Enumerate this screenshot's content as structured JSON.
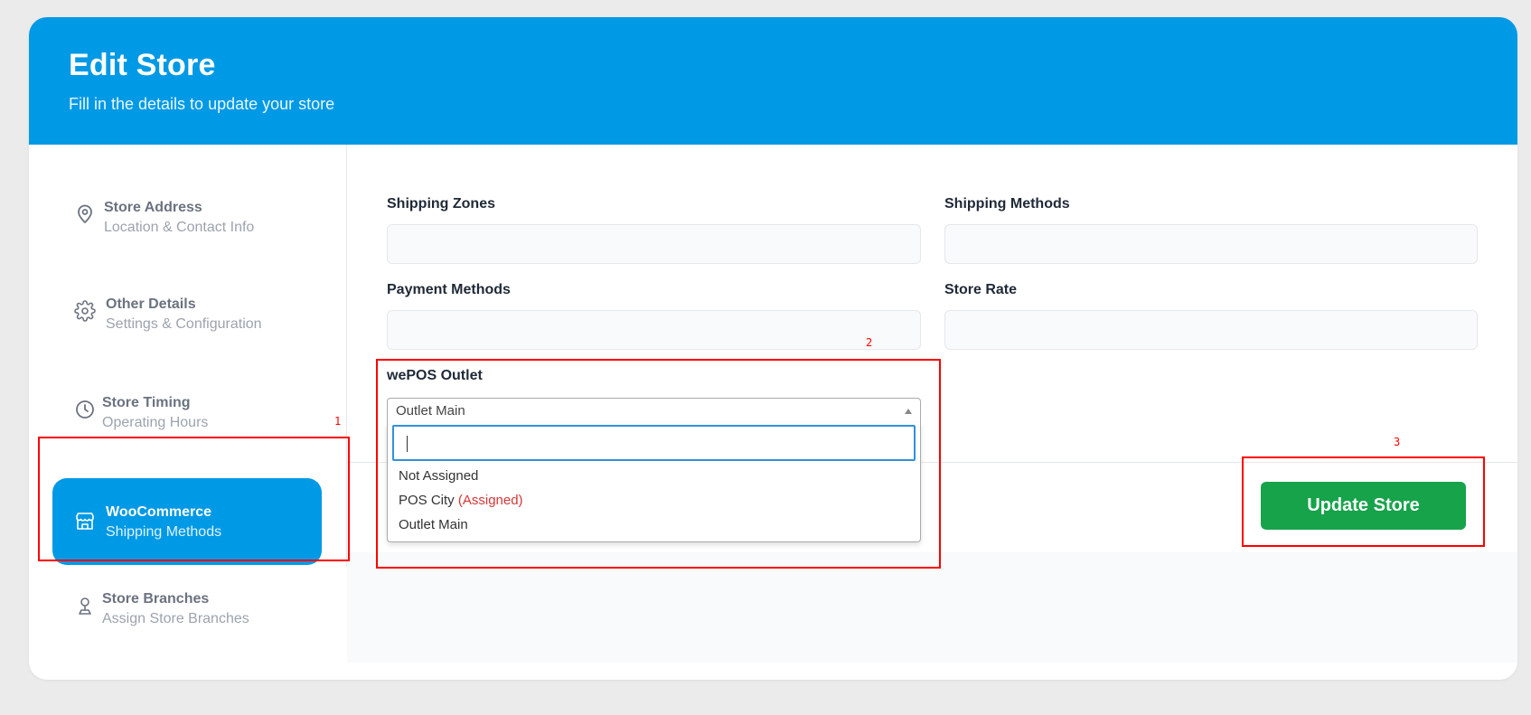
{
  "header": {
    "title": "Edit Store",
    "subtitle": "Fill in the details to update your store",
    "background_color": "#0099e5"
  },
  "sidebar": {
    "items": [
      {
        "title": "Store Address",
        "subtitle": "Location & Contact Info",
        "icon": "map-pin-icon",
        "active": false
      },
      {
        "title": "Other Details",
        "subtitle": "Settings & Configuration",
        "icon": "gear-icon",
        "active": false
      },
      {
        "title": "Store Timing",
        "subtitle": "Operating Hours",
        "icon": "clock-icon",
        "active": false
      },
      {
        "title": "WooCommerce",
        "subtitle": "Shipping Methods",
        "icon": "store-icon",
        "active": true
      },
      {
        "title": "Store Branches",
        "subtitle": "Assign Store Branches",
        "icon": "branch-pin-icon",
        "active": false
      }
    ]
  },
  "form": {
    "shipping_zones": {
      "label": "Shipping Zones",
      "value": ""
    },
    "shipping_methods": {
      "label": "Shipping Methods",
      "value": ""
    },
    "payment_methods": {
      "label": "Payment Methods",
      "value": ""
    },
    "store_rate": {
      "label": "Store Rate",
      "value": ""
    },
    "wepos_outlet": {
      "label": "wePOS Outlet",
      "selected": "Outlet Main",
      "search_value": "",
      "options": [
        {
          "label": "Not Assigned",
          "tag": ""
        },
        {
          "label": "POS City",
          "tag": "(Assigned)"
        },
        {
          "label": "Outlet Main",
          "tag": ""
        }
      ]
    }
  },
  "actions": {
    "update_label": "Update Store",
    "update_color": "#16a34a"
  },
  "annotations": {
    "markers": [
      "1",
      "2",
      "3"
    ],
    "color": "#ff0000"
  }
}
